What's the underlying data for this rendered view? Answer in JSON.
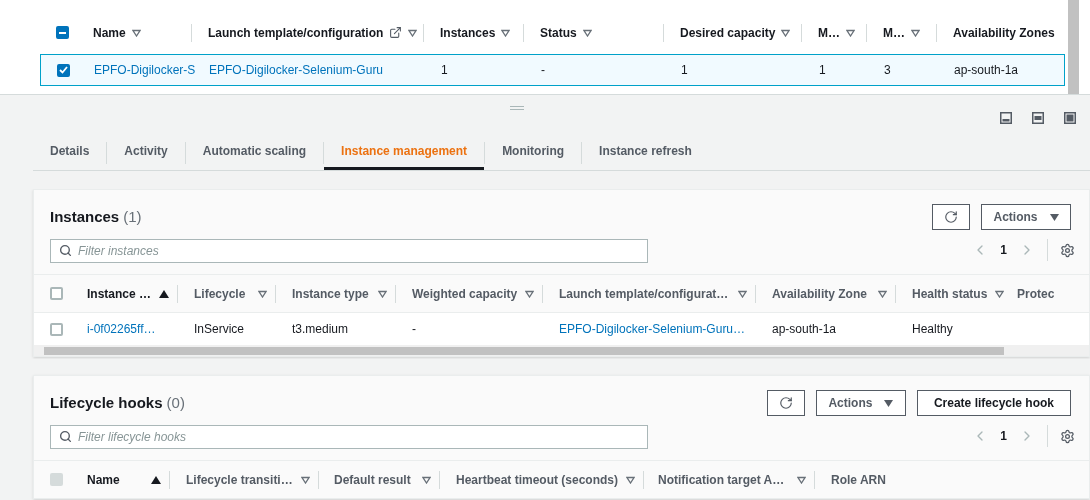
{
  "groups_table": {
    "select_all": {
      "indeterminate": true
    },
    "columns": [
      {
        "label": "Name",
        "sortable": true
      },
      {
        "label": "Launch template/configuration",
        "sortable": true,
        "external_link": true
      },
      {
        "label": "Instances",
        "sortable": true
      },
      {
        "label": "Status",
        "sortable": true
      },
      {
        "label": "Desired capacity",
        "sortable": true
      },
      {
        "label": "M…",
        "sortable": true
      },
      {
        "label": "M…",
        "sortable": true
      },
      {
        "label": "Availability Zones",
        "sortable": false
      }
    ],
    "rows": [
      {
        "selected": true,
        "cells": [
          {
            "text": "EPFO-Digilocker-S",
            "link": true
          },
          {
            "text": "EPFO-Digilocker-Selenium-Guru",
            "link": true
          },
          {
            "text": "1",
            "link": false
          },
          {
            "text": "-",
            "link": false
          },
          {
            "text": "1",
            "link": false
          },
          {
            "text": "1",
            "link": false
          },
          {
            "text": "3",
            "link": false
          },
          {
            "text": "ap-south-1a",
            "link": false
          }
        ]
      }
    ]
  },
  "tabs": [
    {
      "label": "Details",
      "selected": false
    },
    {
      "label": "Activity",
      "selected": false
    },
    {
      "label": "Automatic scaling",
      "selected": false
    },
    {
      "label": "Instance management",
      "selected": true
    },
    {
      "label": "Monitoring",
      "selected": false
    },
    {
      "label": "Instance refresh",
      "selected": false
    }
  ],
  "instances": {
    "title": "Instances",
    "count": "(1)",
    "actions": "Actions",
    "filter": {
      "placeholder": "Filter instances"
    },
    "page": "1",
    "select_all": {
      "checked": false
    },
    "columns": [
      {
        "label": "Instance …",
        "sortable": true,
        "sorted": true
      },
      {
        "label": "Lifecycle",
        "sortable": true,
        "sorted": false
      },
      {
        "label": "Instance type",
        "sortable": true,
        "sorted": false
      },
      {
        "label": "Weighted capacity",
        "sortable": true,
        "sorted": false
      },
      {
        "label": "Launch template/configurat…",
        "sortable": true,
        "sorted": false
      },
      {
        "label": "Availability Zone",
        "sortable": true,
        "sorted": false
      },
      {
        "label": "Health status",
        "sortable": true,
        "sorted": false
      },
      {
        "label": "Protec",
        "sortable": false
      }
    ],
    "rows": [
      {
        "selected": false,
        "cells": [
          {
            "text": "i-0f02265ff…",
            "link": true
          },
          {
            "text": "InService",
            "link": false
          },
          {
            "text": "t3.medium",
            "link": false
          },
          {
            "text": "-",
            "link": false
          },
          {
            "text": "EPFO-Digilocker-Selenium-Guru…",
            "link": true
          },
          {
            "text": "ap-south-1a",
            "link": false
          },
          {
            "text": "Healthy",
            "link": false
          }
        ]
      }
    ]
  },
  "lifecycle_hooks": {
    "title": "Lifecycle hooks",
    "count": "(0)",
    "actions": "Actions",
    "create": "Create lifecycle hook",
    "filter": {
      "placeholder": "Filter lifecycle hooks"
    },
    "page": "1",
    "select_all": {
      "checked": false,
      "disabled": true
    },
    "columns": [
      {
        "label": "Name",
        "sortable": true,
        "sorted": true
      },
      {
        "label": "Lifecycle transiti…",
        "sortable": true,
        "sorted": false
      },
      {
        "label": "Default result",
        "sortable": true,
        "sorted": false
      },
      {
        "label": "Heartbeat timeout (seconds)",
        "sortable": true,
        "sorted": false
      },
      {
        "label": "Notification target A…",
        "sortable": true,
        "sorted": false
      },
      {
        "label": "Role ARN",
        "sortable": false
      }
    ]
  }
}
